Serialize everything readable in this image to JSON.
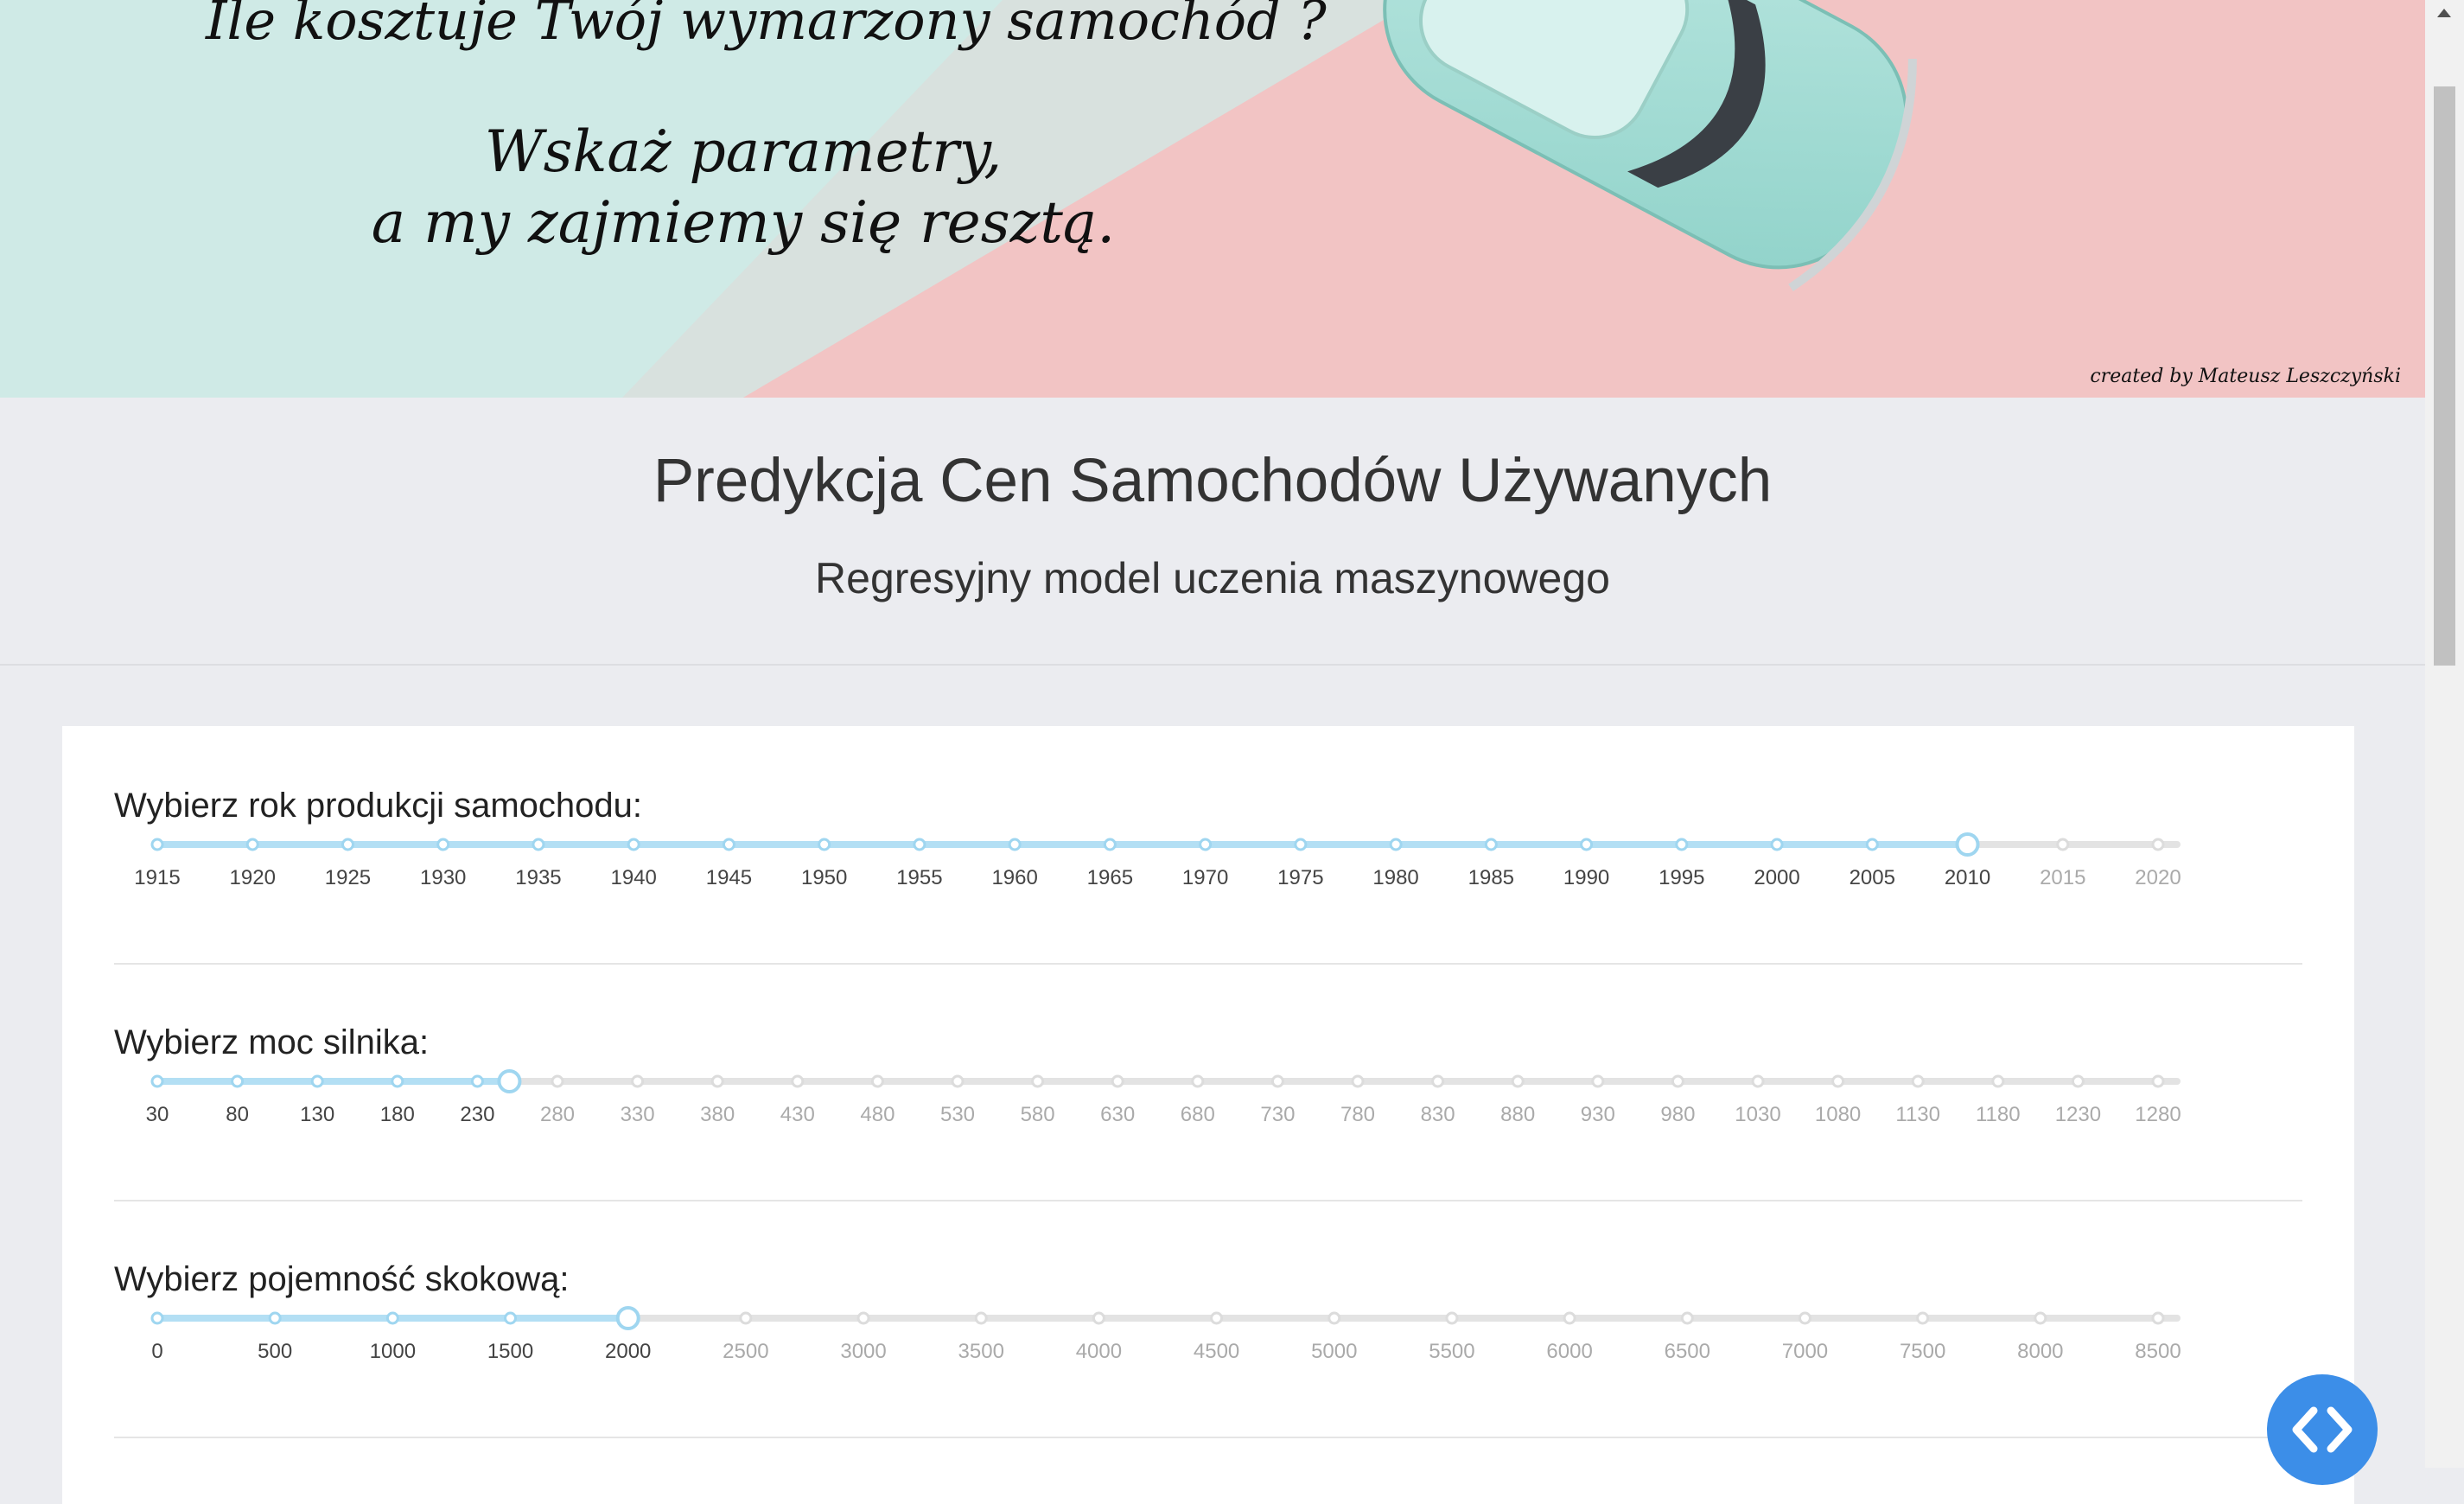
{
  "banner": {
    "line1": "Ile kosztuje Twój wymarzony samochód ?",
    "line2": "Wskaż parametry,",
    "line3": "a my zajmiemy się resztą.",
    "credit": "created by Mateusz Leszczyński"
  },
  "header": {
    "title": "Predykcja Cen Samochodów Używanych",
    "subtitle": "Regresyjny model uczenia maszynowego"
  },
  "sliders": [
    {
      "label": "Wybierz rok produkcji samochodu:",
      "ticks": [
        "1915",
        "1920",
        "1925",
        "1930",
        "1935",
        "1940",
        "1945",
        "1950",
        "1955",
        "1960",
        "1965",
        "1970",
        "1975",
        "1980",
        "1985",
        "1990",
        "1995",
        "2000",
        "2005",
        "2010",
        "2015",
        "2020"
      ],
      "min": 1915,
      "max": 2020,
      "value": 2010
    },
    {
      "label": "Wybierz moc silnika:",
      "ticks": [
        "30",
        "80",
        "130",
        "180",
        "230",
        "280",
        "330",
        "380",
        "430",
        "480",
        "530",
        "580",
        "630",
        "680",
        "730",
        "780",
        "830",
        "880",
        "930",
        "980",
        "1030",
        "1080",
        "1130",
        "1180",
        "1230",
        "1280"
      ],
      "min": 30,
      "max": 1330,
      "value": 250
    },
    {
      "label": "Wybierz pojemność skokową:",
      "ticks": [
        "0",
        "500",
        "1000",
        "1500",
        "2000",
        "2500",
        "3000",
        "3500",
        "4000",
        "4500",
        "5000",
        "5500",
        "6000",
        "6500",
        "7000",
        "7500",
        "8000",
        "8500"
      ],
      "min": 0,
      "max": 8500,
      "value": 2000
    }
  ],
  "colors": {
    "track_active": "#b3dff4",
    "track_inactive": "#e3e3e3",
    "dot_active": "#9fd6f0",
    "code_button": "#3c8ee8"
  },
  "icons": {
    "code_button": "code-brackets-icon"
  }
}
